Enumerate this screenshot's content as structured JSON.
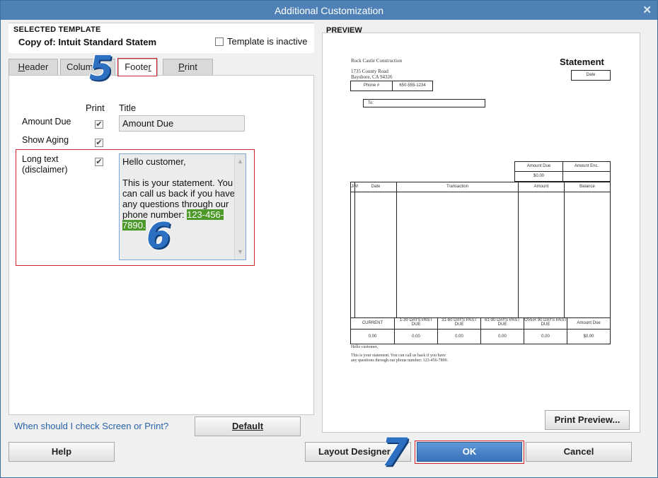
{
  "window": {
    "title": "Additional Customization"
  },
  "selected_template": {
    "header": "SELECTED TEMPLATE",
    "name": "Copy of: Intuit Standard Statem",
    "inactive_label": "Template is inactive"
  },
  "tabs": [
    {
      "label": "Header",
      "underline": "H",
      "rest": "eader"
    },
    {
      "label": "Columns",
      "text": "Colum"
    },
    {
      "label": "Footer",
      "pre": "Foote",
      "underline": "r"
    },
    {
      "label": "Print",
      "underline": "P",
      "rest": "rint"
    }
  ],
  "footer": {
    "col_print": "Print",
    "col_title": "Title",
    "amount_due_label": "Amount Due",
    "amount_due_title": "Amount Due",
    "show_aging_label": "Show Aging",
    "long_text_label": "Long text\n(disclaimer)",
    "long_text_plain": "Hello customer,\n\nThis is your statement. You can call us back if you have any questions through our phone number: ",
    "long_text_highlight": "123-456-7890."
  },
  "link": "When should I check Screen or Print?",
  "buttons": {
    "default": "Default",
    "help": "Help",
    "layout_designer": "Layout Designer...",
    "ok": "OK",
    "cancel": "Cancel",
    "print_preview": "Print Preview..."
  },
  "callouts": {
    "five": "5",
    "six": "6",
    "seven": "7"
  },
  "preview": {
    "label": "PREVIEW",
    "company": "Rock Castle Construction",
    "address1": "1735 County Road",
    "address2": "Bayshore, CA 94326",
    "phone_label": "Phone #",
    "phone": "650-555-1234",
    "doc_title": "Statement",
    "date_label": "Date",
    "to_label": "To:",
    "amount_due": "Amount Due",
    "amount_enc": "Amount Enc.",
    "amount_due_value": "$0.00",
    "col_jm": "J/M",
    "col_date": "Date",
    "col_transaction": "Transaction",
    "col_amount": "Amount",
    "col_balance": "Balance",
    "aging": [
      "CURRENT",
      "1-30 DAYS PAST DUE",
      "31-60 DAYS PAST DUE",
      "61-90 DAYS PAST DUE",
      "OVER 90 DAYS PAST DUE",
      "Amount Due"
    ],
    "aging_values": [
      "0.00",
      "0.00",
      "0.00",
      "0.00",
      "0.00",
      "$0.00"
    ],
    "footer1": "Hello customer,",
    "footer2": "This is your statement. You can call us back if you have",
    "footer3": "any questions through our phone number: 123-456-7890."
  }
}
